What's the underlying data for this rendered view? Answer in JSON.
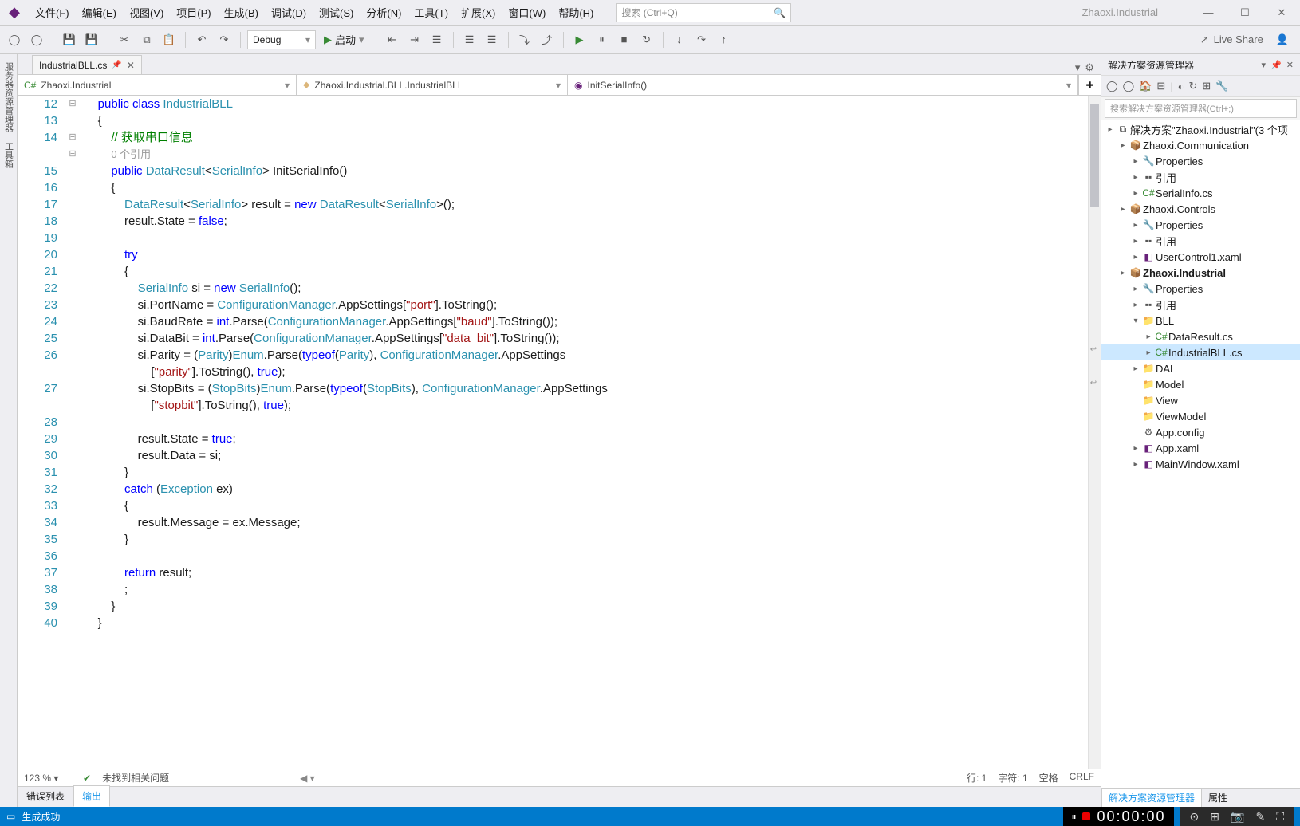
{
  "title": {
    "solution": "Zhaoxi.Industrial",
    "search_placeholder": "搜索 (Ctrl+Q)"
  },
  "menu": [
    "文件(F)",
    "编辑(E)",
    "视图(V)",
    "项目(P)",
    "生成(B)",
    "调试(D)",
    "测试(S)",
    "分析(N)",
    "工具(T)",
    "扩展(X)",
    "窗口(W)",
    "帮助(H)"
  ],
  "toolbar": {
    "config": "Debug",
    "start": "启动",
    "liveshare": "Live Share"
  },
  "left_rail": [
    "服务器资源管理器",
    "工具箱"
  ],
  "tabs": {
    "file": "IndustrialBLL.cs"
  },
  "navbar": {
    "project": "Zhaoxi.Industrial",
    "namespace": "Zhaoxi.Industrial.BLL.IndustrialBLL",
    "member": "InitSerialInfo()"
  },
  "code": {
    "line_start": 12,
    "lines": [
      {
        "n": 12,
        "html": "    <span class='kw'>public</span> <span class='kw'>class</span> <span class='typ'>IndustrialBLL</span>"
      },
      {
        "n": 13,
        "html": "    {"
      },
      {
        "n": 14,
        "html": "        <span class='cmt'>// 获取串口信息</span>",
        "extra": "        <span class='ref'>0 个引用</span>"
      },
      {
        "n": 15,
        "html": "        <span class='kw'>public</span> <span class='typ'>DataResult</span>&lt;<span class='typ'>SerialInfo</span>&gt; InitSerialInfo()"
      },
      {
        "n": 16,
        "html": "        {"
      },
      {
        "n": 17,
        "html": "            <span class='typ'>DataResult</span>&lt;<span class='typ'>SerialInfo</span>&gt; result = <span class='kw'>new</span> <span class='typ'>DataResult</span>&lt;<span class='typ'>SerialInfo</span>&gt;();"
      },
      {
        "n": 18,
        "html": "            result.State = <span class='kw'>false</span>;"
      },
      {
        "n": 19,
        "html": ""
      },
      {
        "n": 20,
        "html": "            <span class='kw'>try</span>"
      },
      {
        "n": 21,
        "html": "            {"
      },
      {
        "n": 22,
        "html": "                <span class='typ'>SerialInfo</span> si = <span class='kw'>new</span> <span class='typ'>SerialInfo</span>();"
      },
      {
        "n": 23,
        "html": "                si.PortName = <span class='typ'>ConfigurationManager</span>.AppSettings[<span class='str'>\"port\"</span>].ToString();"
      },
      {
        "n": 24,
        "html": "                si.BaudRate = <span class='kw'>int</span>.Parse(<span class='typ'>ConfigurationManager</span>.AppSettings[<span class='str'>\"baud\"</span>].ToString());"
      },
      {
        "n": 25,
        "html": "                si.DataBit = <span class='kw'>int</span>.Parse(<span class='typ'>ConfigurationManager</span>.AppSettings[<span class='str'>\"data_bit\"</span>].ToString());"
      },
      {
        "n": 26,
        "html": "                si.Parity = (<span class='typ'>Parity</span>)<span class='typ'>Enum</span>.Parse(<span class='kw'>typeof</span>(<span class='typ'>Parity</span>), <span class='typ'>ConfigurationManager</span>.AppSettings",
        "extra": "                    [<span class='str'>\"parity\"</span>].ToString(), <span class='kw'>true</span>);"
      },
      {
        "n": 27,
        "html": "                si.StopBits = (<span class='typ'>StopBits</span>)<span class='typ'>Enum</span>.Parse(<span class='kw'>typeof</span>(<span class='typ'>StopBits</span>), <span class='typ'>ConfigurationManager</span>.AppSettings",
        "extra": "                    [<span class='str'>\"stopbit\"</span>].ToString(), <span class='kw'>true</span>);"
      },
      {
        "n": 28,
        "html": ""
      },
      {
        "n": 29,
        "html": "                result.State = <span class='kw'>true</span>;"
      },
      {
        "n": 30,
        "html": "                result.Data = si;"
      },
      {
        "n": 31,
        "html": "            }"
      },
      {
        "n": 32,
        "html": "            <span class='kw'>catch</span> (<span class='typ'>Exception</span> ex)"
      },
      {
        "n": 33,
        "html": "            {"
      },
      {
        "n": 34,
        "html": "                result.Message = ex.Message;"
      },
      {
        "n": 35,
        "html": "            }"
      },
      {
        "n": 36,
        "html": ""
      },
      {
        "n": 37,
        "html": "            <span class='kw'>return</span> result;"
      },
      {
        "n": 38,
        "html": "            ;"
      },
      {
        "n": 39,
        "html": "        }"
      },
      {
        "n": 40,
        "html": "    }"
      }
    ]
  },
  "editor_status": {
    "zoom": "123 %",
    "issues": "未找到相关问题",
    "line": "行: 1",
    "col": "字符: 1",
    "ins": "空格",
    "eol": "CRLF"
  },
  "bottom_tabs": {
    "errors": "错误列表",
    "output": "输出"
  },
  "solution": {
    "title": "解决方案资源管理器",
    "search": "搜索解决方案资源管理器(Ctrl+;)",
    "root": "解决方案\"Zhaoxi.Industrial\"(3 个项",
    "nodes": [
      {
        "d": 1,
        "exp": "▸",
        "ico": "📦",
        "cls": "ico-proj",
        "t": "Zhaoxi.Communication"
      },
      {
        "d": 2,
        "exp": "▸",
        "ico": "🔧",
        "cls": "ico-prop",
        "t": "Properties"
      },
      {
        "d": 2,
        "exp": "▸",
        "ico": "▪▪",
        "cls": "ico-ref",
        "t": "引用"
      },
      {
        "d": 2,
        "exp": "▸",
        "ico": "C#",
        "cls": "ico-cs",
        "t": "SerialInfo.cs"
      },
      {
        "d": 1,
        "exp": "▸",
        "ico": "📦",
        "cls": "ico-proj",
        "t": "Zhaoxi.Controls"
      },
      {
        "d": 2,
        "exp": "▸",
        "ico": "🔧",
        "cls": "ico-prop",
        "t": "Properties"
      },
      {
        "d": 2,
        "exp": "▸",
        "ico": "▪▪",
        "cls": "ico-ref",
        "t": "引用"
      },
      {
        "d": 2,
        "exp": "▸",
        "ico": "◧",
        "cls": "ico-xaml",
        "t": "UserControl1.xaml"
      },
      {
        "d": 1,
        "exp": "▸",
        "ico": "📦",
        "cls": "ico-proj bold",
        "t": "Zhaoxi.Industrial"
      },
      {
        "d": 2,
        "exp": "▸",
        "ico": "🔧",
        "cls": "ico-prop",
        "t": "Properties"
      },
      {
        "d": 2,
        "exp": "▸",
        "ico": "▪▪",
        "cls": "ico-ref",
        "t": "引用"
      },
      {
        "d": 2,
        "exp": "▾",
        "ico": "📁",
        "cls": "ico-fold",
        "t": "BLL"
      },
      {
        "d": 3,
        "exp": "▸",
        "ico": "C#",
        "cls": "ico-cs",
        "t": "DataResult.cs"
      },
      {
        "d": 3,
        "exp": "▸",
        "ico": "C#",
        "cls": "ico-cs",
        "t": "IndustrialBLL.cs",
        "sel": true
      },
      {
        "d": 2,
        "exp": "▸",
        "ico": "📁",
        "cls": "ico-fold",
        "t": "DAL"
      },
      {
        "d": 2,
        "exp": "",
        "ico": "📁",
        "cls": "ico-fold",
        "t": "Model"
      },
      {
        "d": 2,
        "exp": "",
        "ico": "📁",
        "cls": "ico-fold",
        "t": "View"
      },
      {
        "d": 2,
        "exp": "",
        "ico": "📁",
        "cls": "ico-fold",
        "t": "ViewModel"
      },
      {
        "d": 2,
        "exp": "",
        "ico": "⚙",
        "cls": "ico-cfg",
        "t": "App.config"
      },
      {
        "d": 2,
        "exp": "▸",
        "ico": "◧",
        "cls": "ico-xaml",
        "t": "App.xaml"
      },
      {
        "d": 2,
        "exp": "▸",
        "ico": "◧",
        "cls": "ico-xaml",
        "t": "MainWindow.xaml"
      }
    ],
    "bottom_tabs": {
      "sol": "解决方案资源管理器",
      "prop": "属性"
    }
  },
  "status": {
    "build": "生成成功",
    "timer": "00:00:00"
  }
}
